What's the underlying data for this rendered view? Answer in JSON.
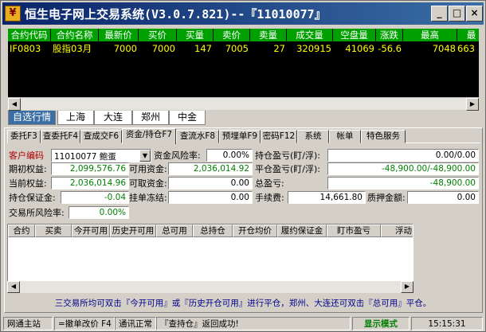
{
  "window": {
    "title": "恒生电子网上交易系统(V3.0.7.821)--『11010077』",
    "icon_glyph": "¥",
    "controls": [
      "_",
      "□",
      "×"
    ]
  },
  "quote_table": {
    "headers": [
      "合约代码",
      "合约名称",
      "最新价",
      "买价",
      "买量",
      "卖价",
      "卖量",
      "成交量",
      "空盘量",
      "涨跌",
      "最高",
      "最"
    ],
    "rows": [
      [
        "IF0803",
        "股指03月",
        "7000",
        "7000",
        "147",
        "7005",
        "27",
        "320915",
        "41069",
        "-56.6",
        "7048",
        "663"
      ]
    ]
  },
  "market_tabs": [
    {
      "label": "自选行情",
      "active": true
    },
    {
      "label": "上海",
      "active": false
    },
    {
      "label": "大连",
      "active": false
    },
    {
      "label": "郑州",
      "active": false
    },
    {
      "label": "中金",
      "active": false
    }
  ],
  "function_tabs": [
    {
      "label": "委托F3",
      "active": false
    },
    {
      "label": "查委托F4",
      "active": false
    },
    {
      "label": "查成交F6",
      "active": false
    },
    {
      "label": "资金/持仓F7",
      "active": true
    },
    {
      "label": "查流水F8",
      "active": false
    },
    {
      "label": "预埋单F9",
      "active": false
    },
    {
      "label": "密码F12",
      "active": false
    },
    {
      "label": "系统",
      "active": false
    },
    {
      "label": "帐单",
      "active": false
    },
    {
      "label": "特色服务",
      "active": false
    }
  ],
  "funds": {
    "client_code_label": "客户编码",
    "client_code_value": "11010077 鲍蛋",
    "fund_risk_label": "资金风险率:",
    "fund_risk_value": "0.00%",
    "pos_pl_label": "持仓盈亏(盯/浮):",
    "pos_pl_value": "0.00/0.00",
    "init_equity_label": "期初权益:",
    "init_equity_value": "2,099,576.76",
    "avail_label": "可用资金:",
    "avail_value": "2,036,014.92",
    "close_pl_label": "平仓盈亏(盯/浮):",
    "close_pl_value": "-48,900.00/-48,900.00",
    "cur_equity_label": "当前权益:",
    "cur_equity_value": "2,036,014.96",
    "withdraw_label": "可取资金:",
    "withdraw_value": "0.00",
    "total_pl_label": "总盈亏:",
    "total_pl_value": "-48,900.00",
    "margin_label": "持仓保证金:",
    "margin_value": "-0.04",
    "frozen_label": "挂单冻结:",
    "frozen_value": "0.00",
    "fee_label": "手续费:",
    "fee_value": "14,661.80",
    "pledge_label": "质押金额:",
    "pledge_value": "0.00",
    "exch_risk_label": "交易所风险率:",
    "exch_risk_value": "0.00%"
  },
  "positions_table": {
    "headers": [
      "合约",
      "买卖",
      "今开可用",
      "历史开可用",
      "总可用",
      "总持仓",
      "开仓均价",
      "履约保证金",
      "盯市盈亏",
      "浮动"
    ]
  },
  "note": "三交易所均可双击『今开可用』或『历史开仓可用』进行平仓，郑州、大连还可双击『总可用』平仓。",
  "status_bar": {
    "site": "网通主站",
    "hint": "=撤单改价 F4",
    "conn": "通讯正常",
    "msg": "『查持仓』返回成功!",
    "mode": "显示模式",
    "time": "15:15:31"
  }
}
